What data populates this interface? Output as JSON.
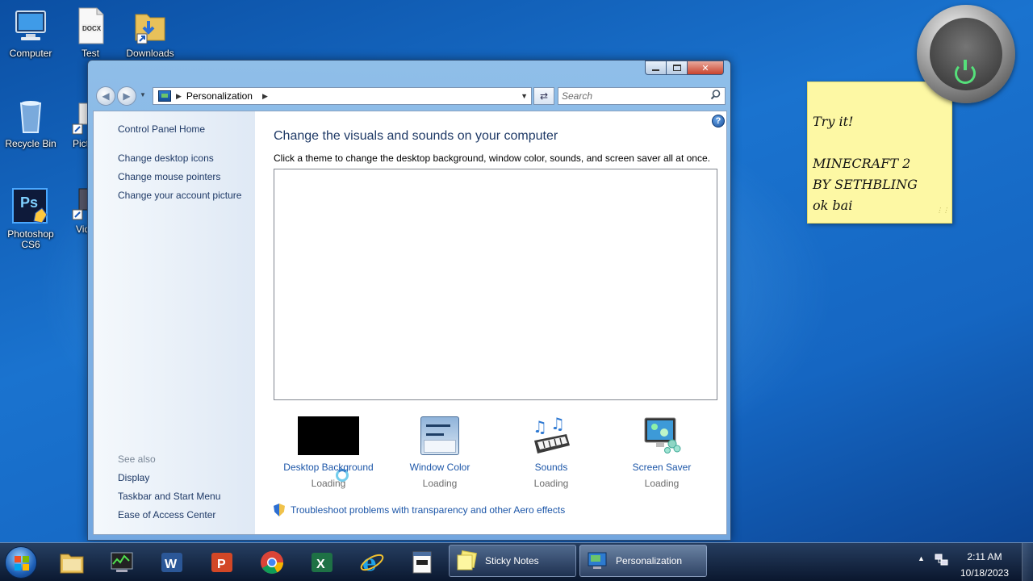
{
  "desktop": {
    "icons": [
      {
        "label": "Computer"
      },
      {
        "label": "Test",
        "badge": "DOCX"
      },
      {
        "label": "Downloads"
      },
      {
        "label": "Recycle Bin"
      },
      {
        "label": "Pictu"
      },
      {
        "label": "Photoshop CS6",
        "badge": "Ps"
      },
      {
        "label": "Vide"
      }
    ]
  },
  "window": {
    "breadcrumb": "Personalization",
    "search_placeholder": "Search",
    "left_links": [
      "Control Panel Home",
      "Change desktop icons",
      "Change mouse pointers",
      "Change your account picture"
    ],
    "see_also_label": "See also",
    "see_also_links": [
      "Display",
      "Taskbar and Start Menu",
      "Ease of Access Center"
    ],
    "title": "Change the visuals and sounds on your computer",
    "description": "Click a theme to change the desktop background, window color, sounds, and screen saver all at once.",
    "help": "?",
    "tiles": [
      {
        "name": "Desktop Background",
        "status": "Loading"
      },
      {
        "name": "Window Color",
        "status": "Loading"
      },
      {
        "name": "Sounds",
        "status": "Loading"
      },
      {
        "name": "Screen Saver",
        "status": "Loading"
      }
    ],
    "troubleshoot": "Troubleshoot problems with transparency and other Aero effects"
  },
  "sticky_note": {
    "lines": [
      "Try it!",
      "",
      "MINECRAFT 2",
      "BY SETHBLING",
      "ok bai"
    ]
  },
  "taskbar": {
    "tasks": [
      {
        "label": "Sticky Notes"
      },
      {
        "label": "Personalization"
      }
    ],
    "time": "2:11 AM",
    "date": "10/18/2023"
  },
  "colors": {
    "link": "#1c56a8",
    "heading": "#1e3966",
    "note": "#fdf8a4"
  }
}
